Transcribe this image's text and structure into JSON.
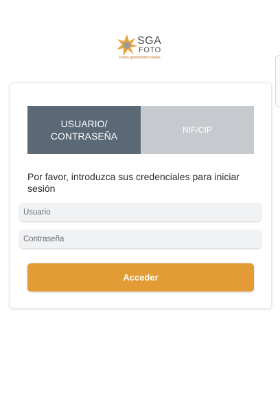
{
  "logo": {
    "word_top": "SGA",
    "word_bottom": "FOTO",
    "tagline": "Fotos georreferenciadas"
  },
  "tabs": [
    {
      "label": "USUARIO/ CONTRASEÑA",
      "active": true
    },
    {
      "label": "NIF/CIP",
      "active": false
    }
  ],
  "instructions": "Por favor, introduzca sus credenciales para iniciar sesión",
  "fields": {
    "user_placeholder": "Usuario",
    "user_value": "",
    "password_placeholder": "Contraseña",
    "password_value": ""
  },
  "button": {
    "label": "Acceder"
  },
  "colors": {
    "tab_active": "#5b6977",
    "tab_inactive": "#c6cace",
    "button": "#e29b35",
    "logo_orange": "#e8a33b"
  }
}
